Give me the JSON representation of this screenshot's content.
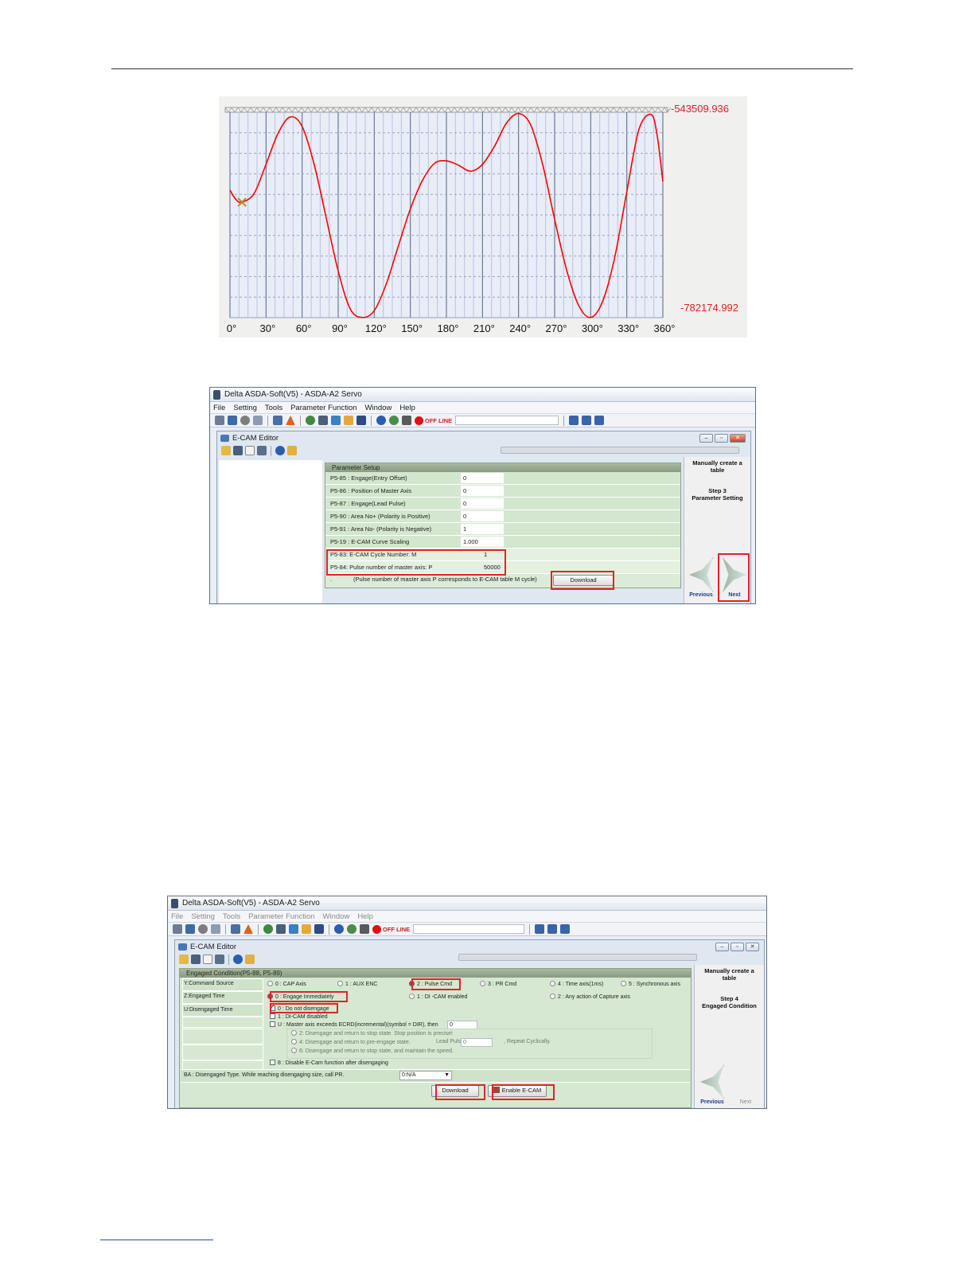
{
  "chart_data": {
    "type": "line",
    "x_ticks": [
      "0°",
      "30°",
      "60°",
      "90°",
      "120°",
      "150°",
      "180°",
      "210°",
      "240°",
      "270°",
      "300°",
      "330°",
      "360°"
    ],
    "y_max_label": "-543509.936",
    "y_min_label": "-782174.992",
    "ylim": [
      -782174.992,
      -543509.936
    ],
    "xlim": [
      0,
      360
    ],
    "series": [
      {
        "x": [
          0,
          5,
          10,
          20,
          30,
          40,
          50,
          60,
          70,
          80,
          90,
          100,
          110,
          120,
          130,
          140,
          150,
          160,
          170,
          180,
          190,
          200,
          210,
          220,
          230,
          240,
          250,
          260,
          270,
          280,
          290,
          300,
          310,
          320,
          330,
          340,
          350,
          355,
          360
        ],
        "values": [
          -634000,
          -645000,
          -648000,
          -638000,
          -604000,
          -568000,
          -549000,
          -560000,
          -604000,
          -666000,
          -728000,
          -772000,
          -782000,
          -774000,
          -743000,
          -699000,
          -656000,
          -623000,
          -603000,
          -600000,
          -605000,
          -612000,
          -604000,
          -583000,
          -556000,
          -545000,
          -558000,
          -604000,
          -668000,
          -727000,
          -768000,
          -782000,
          -763000,
          -712000,
          -636000,
          -564000,
          -546000,
          -568000,
          -624000
        ],
        "color": "#ff0000"
      }
    ],
    "marker": {
      "x": 10,
      "y": -648000
    },
    "grid": true
  },
  "app_title": "Delta ASDA-Soft(V5) - ASDA-A2 Servo",
  "menu": [
    "File",
    "Setting",
    "Tools",
    "Parameter Function",
    "Window",
    "Help"
  ],
  "offline_label": "OFF LINE",
  "editor_title": "E-CAM Editor",
  "win1": {
    "panel_title": "Parameter Setup",
    "rows": [
      {
        "label": "P5-85 : Engage(Entry Offset)",
        "value": "0"
      },
      {
        "label": "P5-86 : Position of Master Axis",
        "value": "0"
      },
      {
        "label": "P5-87 : Engage(Lead Pulse)",
        "value": "0"
      },
      {
        "label": "P5-90 : Area No+ (Polarity is Positive)",
        "value": "0"
      },
      {
        "label": "P5-91 : Area No- (Polarity is Negative)",
        "value": "1"
      },
      {
        "label": "P5-19 : E-CAM Curve Scaling",
        "value": "1.000"
      },
      {
        "label": "P5-83: E-CAM Cycle Number: M",
        "value": "1"
      },
      {
        "label": "P5-84:  Pulse number of master axis: P",
        "value": "50000"
      }
    ],
    "note_dot": ".",
    "note": "(Pulse number of master axis P corresponds to E-CAM table M cycle)",
    "download_label": "Download",
    "side_title": "Manually create a table",
    "side_step": "Step 3",
    "side_step_name": "Parameter Setting",
    "prev_label": "Previous",
    "next_label": "Next"
  },
  "win2": {
    "panel_title": "Engaged Condition(P5-88, P5-89)",
    "y_label": "Y:Command Source",
    "y_options": [
      "0 : CAP Axis",
      "1 : AUX  ENC",
      "2 : Pulse Cmd",
      "3 : PR Cmd",
      "4 : Time axis(1ms)",
      "5 : Synchronous axis"
    ],
    "z_label": "Z:Engaged Time",
    "z_options": [
      "0 : Engage Immediately",
      "1 : DI -CAM enabled",
      "2 : Any action of Capture axis"
    ],
    "u_label": "U:Disengaged Time",
    "u_opt0": "0 : Do not disengage",
    "u_opt1": "1 : DI-CAM disabled",
    "u_opt2": "U : Master axis exceeds ECRD(incremental)(symbol = DIR), then",
    "u_opt2_value": "0",
    "u_sub1": "2: Disengage and return to stop state. Stop position is precise!",
    "u_sub2": "4: Disengage and return to pre-engage state.",
    "u_sub2_lead_label": "Lead Pulse",
    "u_sub2_lead_value": "0",
    "u_sub2_repeat": ", Repeat Cyclically.",
    "u_sub3": "6: Disengage and return to stop state, and maintain the speed.",
    "u_opt8": "8 : Disable E-Cam function after disengaging",
    "ba_label": "BA : Disengaged Type. While reaching disengaging size, call PR.",
    "ba_value": "0:N/A",
    "download_label": "Download",
    "enable_label": "Enable E-CAM",
    "side_title": "Manually create a table",
    "side_step": "Step 4",
    "side_step_name": "Engaged Condition",
    "prev_label": "Previous",
    "next_label": "Next"
  }
}
